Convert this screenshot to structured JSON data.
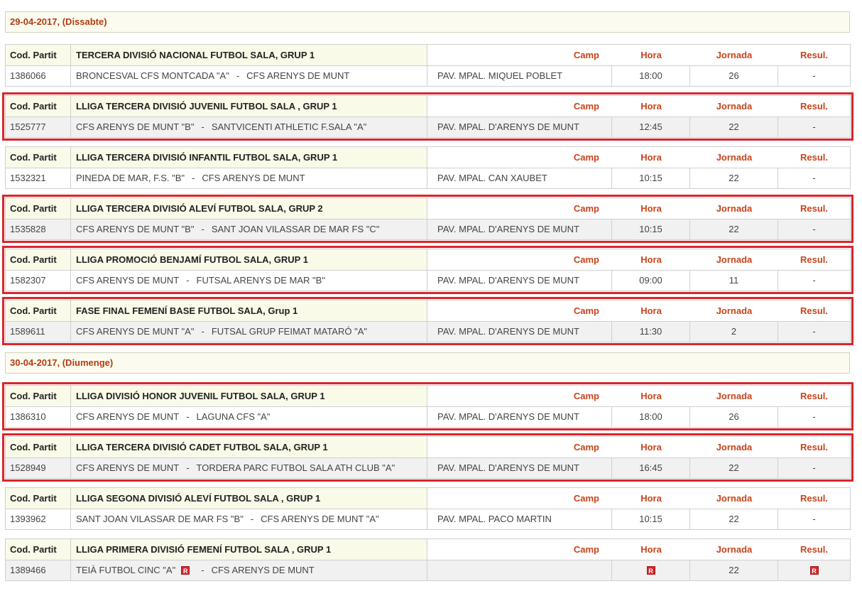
{
  "labels": {
    "code": "Cod. Partit",
    "camp": "Camp",
    "hora": "Hora",
    "jornada": "Jornada",
    "resul": "Resul.",
    "sep": "-",
    "badge": "R"
  },
  "days": [
    {
      "date": "29-04-2017,  (Dissabte)",
      "matches": [
        {
          "competition": "TERCERA DIVISIÓ NACIONAL FUTBOL SALA, GRUP 1",
          "code": "1386066",
          "home": "BRONCESVAL CFS MONTCADA \"A\"",
          "away": "CFS ARENYS DE MUNT",
          "field": "PAV. MPAL. MIQUEL POBLET",
          "time": "18:00",
          "round": "26",
          "result": "-"
        },
        {
          "competition": "LLIGA TERCERA DIVISIÓ JUVENIL FUTBOL SALA , GRUP 1",
          "code": "1525777",
          "home": "CFS ARENYS DE MUNT \"B\"",
          "away": "SANTVICENTI ATHLETIC F.SALA \"A\"",
          "field": "PAV. MPAL. D'ARENYS DE MUNT",
          "time": "12:45",
          "round": "22",
          "result": "-"
        },
        {
          "competition": "LLIGA TERCERA DIVISIÓ INFANTIL FUTBOL SALA, GRUP 1",
          "code": "1532321",
          "home": "PINEDA DE MAR, F.S. \"B\"",
          "away": "CFS ARENYS DE MUNT",
          "field": "PAV. MPAL. CAN XAUBET",
          "time": "10:15",
          "round": "22",
          "result": "-"
        },
        {
          "competition": "LLIGA TERCERA DIVISIÓ ALEVÍ FUTBOL SALA, GRUP 2",
          "code": "1535828",
          "home": "CFS ARENYS DE MUNT \"B\"",
          "away": "SANT JOAN VILASSAR DE MAR FS \"C\"",
          "field": "PAV. MPAL. D'ARENYS DE MUNT",
          "time": "10:15",
          "round": "22",
          "result": "-"
        },
        {
          "competition": "LLIGA PROMOCIÓ BENJAMÍ FUTBOL SALA, GRUP 1",
          "code": "1582307",
          "home": "CFS ARENYS DE MUNT",
          "away": "FUTSAL ARENYS DE MAR \"B\"",
          "field": "PAV. MPAL. D'ARENYS DE MUNT",
          "time": "09:00",
          "round": "11",
          "result": "-"
        },
        {
          "competition": "FASE FINAL FEMENÍ BASE FUTBOL SALA, Grup 1",
          "code": "1589611",
          "home": "CFS ARENYS DE MUNT \"A\"",
          "away": "FUTSAL GRUP FEIMAT MATARÓ \"A\"",
          "field": "PAV. MPAL. D'ARENYS DE MUNT",
          "time": "11:30",
          "round": "2",
          "result": "-"
        }
      ]
    },
    {
      "date": "30-04-2017,  (Diumenge)",
      "matches": [
        {
          "competition": "LLIGA DIVISIÓ HONOR JUVENIL FUTBOL SALA, GRUP 1",
          "code": "1386310",
          "home": "CFS ARENYS DE MUNT",
          "away": "LAGUNA CFS \"A\"",
          "field": "PAV. MPAL. D'ARENYS DE MUNT",
          "time": "18:00",
          "round": "26",
          "result": "-"
        },
        {
          "competition": "LLIGA TERCERA DIVISIÓ CADET FUTBOL SALA, GRUP 1",
          "code": "1528949",
          "home": "CFS ARENYS DE MUNT",
          "away": "TORDERA PARC FUTBOL SALA ATH CLUB \"A\"",
          "field": "PAV. MPAL. D'ARENYS DE MUNT",
          "time": "16:45",
          "round": "22",
          "result": "-"
        },
        {
          "competition": "LLIGA SEGONA DIVISIÓ ALEVÍ FUTBOL SALA , GRUP 1",
          "code": "1393962",
          "home": "SANT JOAN VILASSAR DE MAR FS \"B\"",
          "away": "CFS ARENYS DE MUNT \"A\"",
          "field": "PAV. MPAL. PACO MARTIN",
          "time": "10:15",
          "round": "22",
          "result": "-"
        },
        {
          "competition": "LLIGA PRIMERA DIVISIÓ FEMENÍ FUTBOL SALA , GRUP 1",
          "code": "1389466",
          "home": "TEIÀ FUTBOL CINC \"A\"",
          "away": "CFS ARENYS DE MUNT",
          "field": "",
          "time": "",
          "round": "22",
          "result": ""
        }
      ]
    }
  ]
}
